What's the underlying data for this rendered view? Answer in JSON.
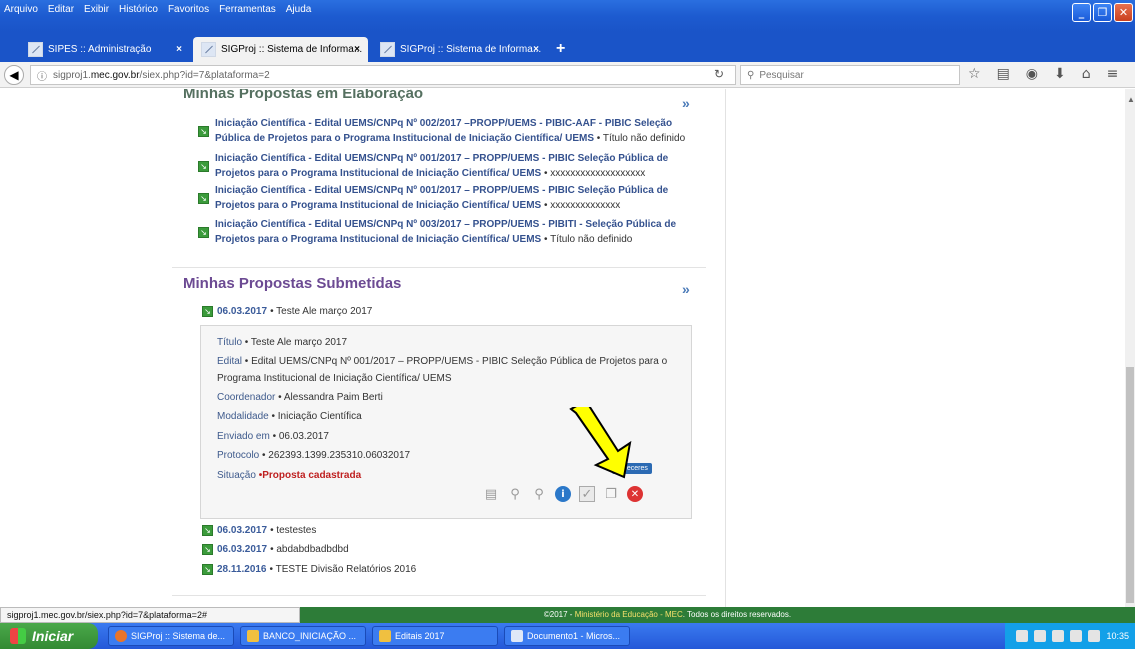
{
  "menubar": {
    "items": [
      "Arquivo",
      "Editar",
      "Exibir",
      "Histórico",
      "Favoritos",
      "Ferramentas",
      "Ajuda"
    ]
  },
  "tabs": [
    {
      "label": "SIPES :: Administração",
      "close": "×"
    },
    {
      "label": "SIGProj :: Sistema de Informa...",
      "close": "×"
    },
    {
      "label": "SIGProj :: Sistema de Informa...",
      "close": "×"
    }
  ],
  "new_tab": "+",
  "navbar": {
    "url_prefix": "sigproj1.",
    "url_domain": "mec.gov.br",
    "url_suffix": "/siex.php?id=7&plataforma=2",
    "search_placeholder": "Pesquisar"
  },
  "section_drafts": {
    "title": "Minhas Propostas em Elaboração",
    "more": "»",
    "items": [
      {
        "link": "Iniciação Científica - Edital UEMS/CNPq Nº 002/2017 –PROPP/UEMS - PIBIC-AAF - PIBIC Seleção Pública de Projetos para o Programa Institucional de Iniciação Científica/ UEMS",
        "suffix": " • Título não definido"
      },
      {
        "link": "Iniciação Científica - Edital UEMS/CNPq Nº 001/2017 – PROPP/UEMS - PIBIC Seleção Pública de Projetos para o Programa Institucional de Iniciação Científica/ UEMS",
        "suffix": " • xxxxxxxxxxxxxxxxxxx"
      },
      {
        "link": "Iniciação Científica - Edital UEMS/CNPq Nº 001/2017 – PROPP/UEMS - PIBIC Seleção Pública de Projetos para o Programa Institucional de Iniciação Científica/ UEMS",
        "suffix": " • xxxxxxxxxxxxxx"
      },
      {
        "link": "Iniciação Científica - Edital UEMS/CNPq Nº 003/2017 – PROPP/UEMS - PIBITI - Seleção Pública de Projetos para o Programa Institucional de Iniciação Científica/ UEMS",
        "suffix": " • Título não definido"
      }
    ]
  },
  "section_submitted": {
    "title": "Minhas Propostas Submetidas",
    "more": "»",
    "first": {
      "date": "06.03.2017",
      "name": "• Teste Ale março 2017"
    },
    "detail": {
      "titulo_label": "Título",
      "titulo_value": " • Teste Ale março 2017",
      "edital_label": "Edital",
      "edital_value": " • Edital UEMS/CNPq Nº 001/2017 – PROPP/UEMS - PIBIC Seleção Pública de Projetos para o Programa Institucional de Iniciação Científica/ UEMS",
      "coord_label": "Coordenador",
      "coord_value": " • Alessandra Paim Berti",
      "mod_label": "Modalidade",
      "mod_value": " • Iniciação Científica",
      "env_label": "Enviado em",
      "env_value": " • 06.03.2017",
      "prot_label": "Protocolo",
      "prot_value": " • 262393.1399.235310.06032017",
      "sit_label": "Situação",
      "sit_value": " •Proposta cadastrada",
      "tooltip": "Pareceres"
    },
    "others": [
      {
        "date": "06.03.2017",
        "name": "• testestes"
      },
      {
        "date": "06.03.2017",
        "name": "• abdabdbadbdbd"
      },
      {
        "date": "28.11.2016",
        "name": "• TESTE Divisão Relatórios 2016"
      }
    ]
  },
  "status_url": "sigproj1.mec.gov.br/siex.php?id=7&plataforma=2#",
  "footer": {
    "prefix": "©2017 - ",
    "mec": "Ministério da Educação - MEC",
    "suffix": ". Todos os direitos reservados."
  },
  "taskbar": {
    "start": "Iniciar",
    "tasks": [
      "SIGProj :: Sistema de...",
      "BANCO_INICIAÇÃO ...",
      "Editais 2017",
      "Documento1 - Micros..."
    ],
    "clock": "10:35"
  },
  "colors": {
    "accent": "#6c4a93",
    "link": "#34518e",
    "status_red": "#bf2020",
    "footer_green": "#2d7c38",
    "arrow_yellow": "#ffff00"
  }
}
